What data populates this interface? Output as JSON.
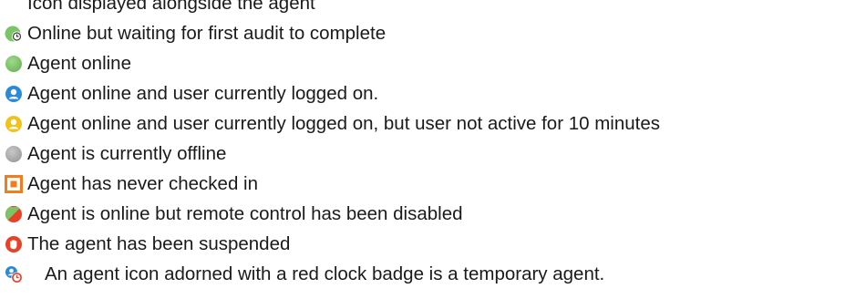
{
  "legend": {
    "header_partial": "Icon displayed alongside the agent",
    "items": [
      {
        "icon": "clock-badge-online-icon",
        "label": "Online but waiting for first audit to complete"
      },
      {
        "icon": "online-dot-icon",
        "label": "Agent online"
      },
      {
        "icon": "user-online-icon",
        "label": "Agent online and user currently logged on."
      },
      {
        "icon": "user-idle-icon",
        "label": "Agent online and user currently logged on, but user not active for 10 minutes"
      },
      {
        "icon": "offline-dot-icon",
        "label": "Agent is currently offline"
      },
      {
        "icon": "never-checked-in-icon",
        "label": "Agent has never checked in"
      },
      {
        "icon": "remote-control-disabled-icon",
        "label": "Agent is online but remote control has been disabled"
      },
      {
        "icon": "suspended-icon",
        "label": "The agent has been suspended"
      },
      {
        "icon": "temporary-agent-icon",
        "label": "An agent icon adorned with a red clock badge is a temporary agent."
      }
    ]
  },
  "colors": {
    "online_green": "#7cc46a",
    "offline_gray": "#a8a8a8",
    "user_blue": "#2a8ad8",
    "idle_yellow": "#f2c21a",
    "never_orange": "#f07e1e",
    "suspended_red": "#e84128",
    "text": "#1a1a1a"
  }
}
